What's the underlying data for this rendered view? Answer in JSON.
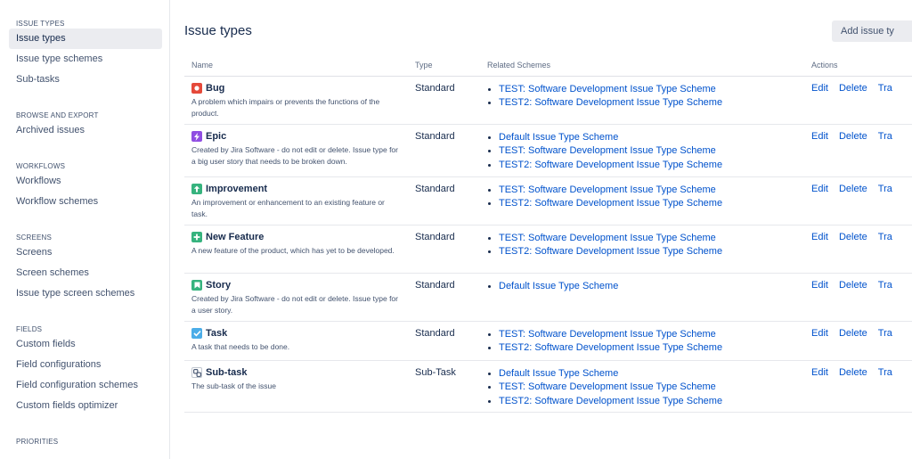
{
  "sidebar": {
    "sections": [
      {
        "title": "ISSUE TYPES",
        "items": [
          {
            "label": "Issue types",
            "active": true
          },
          {
            "label": "Issue type schemes",
            "active": false
          },
          {
            "label": "Sub-tasks",
            "active": false
          }
        ]
      },
      {
        "title": "BROWSE AND EXPORT",
        "items": [
          {
            "label": "Archived issues",
            "active": false
          }
        ]
      },
      {
        "title": "WORKFLOWS",
        "items": [
          {
            "label": "Workflows",
            "active": false
          },
          {
            "label": "Workflow schemes",
            "active": false
          }
        ]
      },
      {
        "title": "SCREENS",
        "items": [
          {
            "label": "Screens",
            "active": false
          },
          {
            "label": "Screen schemes",
            "active": false
          },
          {
            "label": "Issue type screen schemes",
            "active": false
          }
        ]
      },
      {
        "title": "FIELDS",
        "items": [
          {
            "label": "Custom fields",
            "active": false
          },
          {
            "label": "Field configurations",
            "active": false
          },
          {
            "label": "Field configuration schemes",
            "active": false
          },
          {
            "label": "Custom fields optimizer",
            "active": false
          }
        ]
      },
      {
        "title": "PRIORITIES",
        "items": []
      }
    ]
  },
  "main": {
    "title": "Issue types",
    "add_button_label": "Add issue ty",
    "table": {
      "headers": {
        "name": "Name",
        "type": "Type",
        "schemes": "Related Schemes",
        "actions": "Actions"
      },
      "actions": {
        "edit": "Edit",
        "delete": "Delete",
        "translate": "Tra"
      },
      "rows": [
        {
          "name": "Bug",
          "icon": "bug-icon",
          "icon_color": "#e5493a",
          "description": "A problem which impairs or prevents the functions of the product.",
          "type": "Standard",
          "schemes": [
            "TEST: Software Development Issue Type Scheme",
            "TEST2: Software Development Issue Type Scheme"
          ]
        },
        {
          "name": "Epic",
          "icon": "epic-icon",
          "icon_color": "#904ee2",
          "description": "Created by Jira Software - do not edit or delete. Issue type for a big user story that needs to be broken down.",
          "type": "Standard",
          "schemes": [
            "Default Issue Type Scheme",
            "TEST: Software Development Issue Type Scheme",
            "TEST2: Software Development Issue Type Scheme"
          ]
        },
        {
          "name": "Improvement",
          "icon": "improvement-icon",
          "icon_color": "#36b37e",
          "description": "An improvement or enhancement to an existing feature or task.",
          "type": "Standard",
          "schemes": [
            "TEST: Software Development Issue Type Scheme",
            "TEST2: Software Development Issue Type Scheme"
          ]
        },
        {
          "name": "New Feature",
          "icon": "new-feature-icon",
          "icon_color": "#36b37e",
          "description": "A new feature of the product, which has yet to be developed.",
          "type": "Standard",
          "schemes": [
            "TEST: Software Development Issue Type Scheme",
            "TEST2: Software Development Issue Type Scheme"
          ]
        },
        {
          "name": "Story",
          "icon": "story-icon",
          "icon_color": "#36b37e",
          "description": "Created by Jira Software - do not edit or delete. Issue type for a user story.",
          "type": "Standard",
          "schemes": [
            "Default Issue Type Scheme"
          ]
        },
        {
          "name": "Task",
          "icon": "task-icon",
          "icon_color": "#4bade8",
          "description": "A task that needs to be done.",
          "type": "Standard",
          "schemes": [
            "TEST: Software Development Issue Type Scheme",
            "TEST2: Software Development Issue Type Scheme"
          ]
        },
        {
          "name": "Sub-task",
          "icon": "subtask-icon",
          "icon_color": "#4bade8",
          "description": "The sub-task of the issue",
          "type": "Sub-Task",
          "schemes": [
            "Default Issue Type Scheme",
            "TEST: Software Development Issue Type Scheme",
            "TEST2: Software Development Issue Type Scheme"
          ]
        }
      ]
    }
  }
}
